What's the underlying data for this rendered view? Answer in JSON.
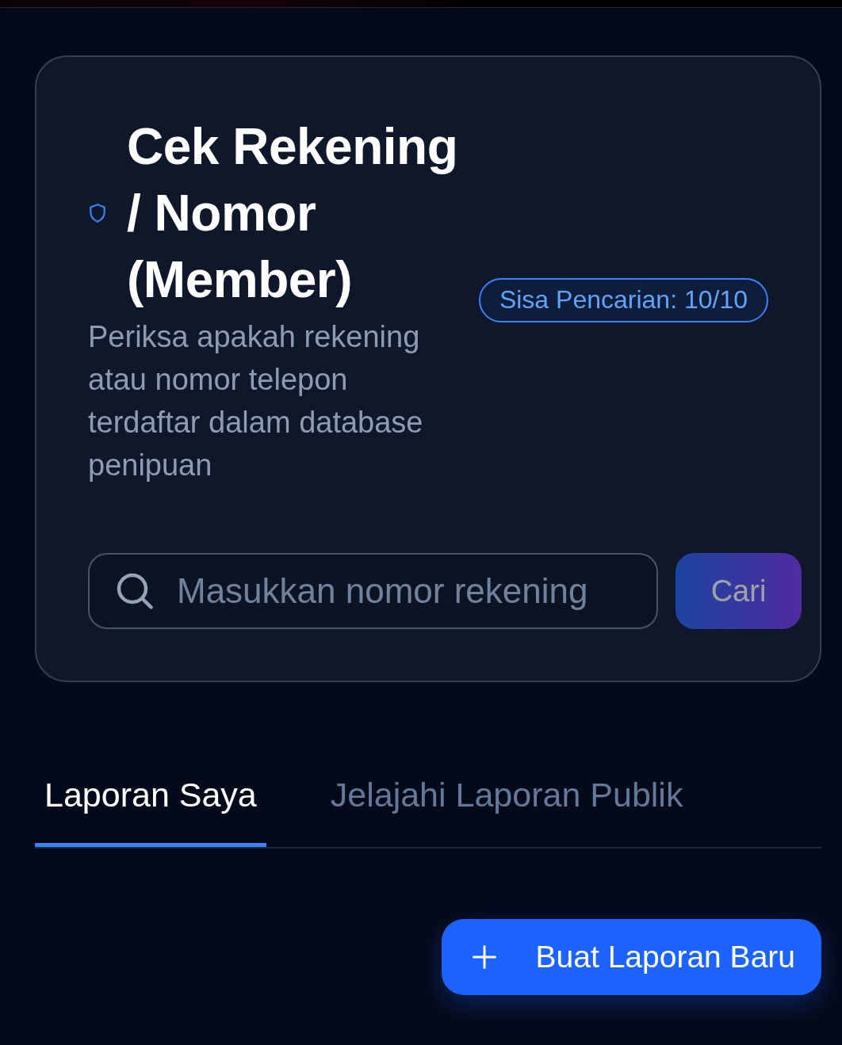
{
  "header": {
    "title": "Cek Rekening / Nomor (Member)",
    "description": "Periksa apakah rekening atau nomor telepon terdaftar dalam database penipuan",
    "badge": "Sisa Pencarian: 10/10"
  },
  "search": {
    "placeholder": "Masukkan nomor rekening",
    "button": {
      "label": "Cari",
      "disabled": true
    }
  },
  "tabs": [
    {
      "label": "Laporan Saya",
      "selected": true
    },
    {
      "label": "Jelajahi Laporan Publik",
      "selected": false
    }
  ],
  "action": {
    "label": "Buat Laporan Baru"
  }
}
